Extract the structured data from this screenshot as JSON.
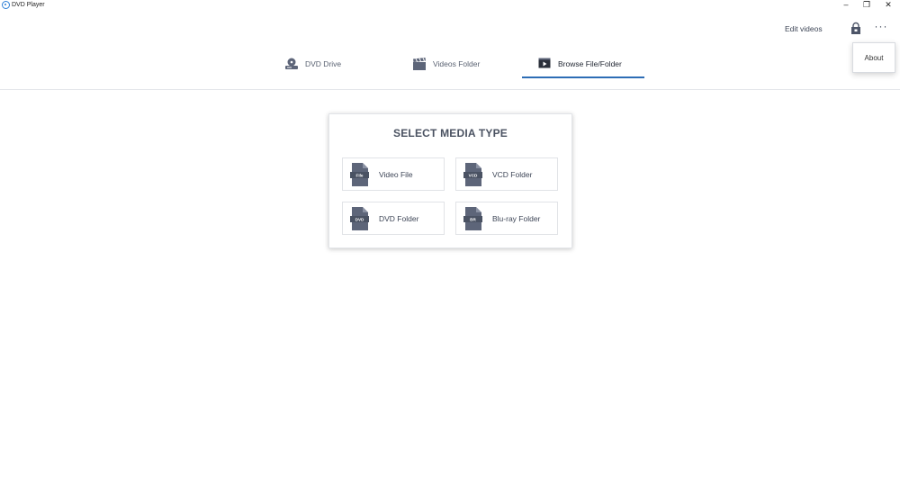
{
  "window": {
    "title": "DVD Player",
    "minimize": "–",
    "maximize": "❐",
    "close": "✕"
  },
  "header": {
    "edit_videos": "Edit videos",
    "more": "···",
    "menu": {
      "about": "About"
    }
  },
  "tabs": [
    {
      "label": "DVD Drive",
      "icon": "dvd-drive-icon"
    },
    {
      "label": "Videos Folder",
      "icon": "clapperboard-icon"
    },
    {
      "label": "Browse File/Folder",
      "icon": "play-folder-icon",
      "active": true
    }
  ],
  "select_media": {
    "title": "SELECT MEDIA TYPE",
    "items": [
      {
        "label": "Video File",
        "icon_text": "File"
      },
      {
        "label": "VCD Folder",
        "icon_text": "VCD"
      },
      {
        "label": "DVD Folder",
        "icon_text": "DVD"
      },
      {
        "label": "Blu-ray Folder",
        "icon_text": "BR"
      }
    ]
  },
  "colors": {
    "accent": "#2d6db5",
    "icon": "#5d6579",
    "text": "#3d4556"
  }
}
